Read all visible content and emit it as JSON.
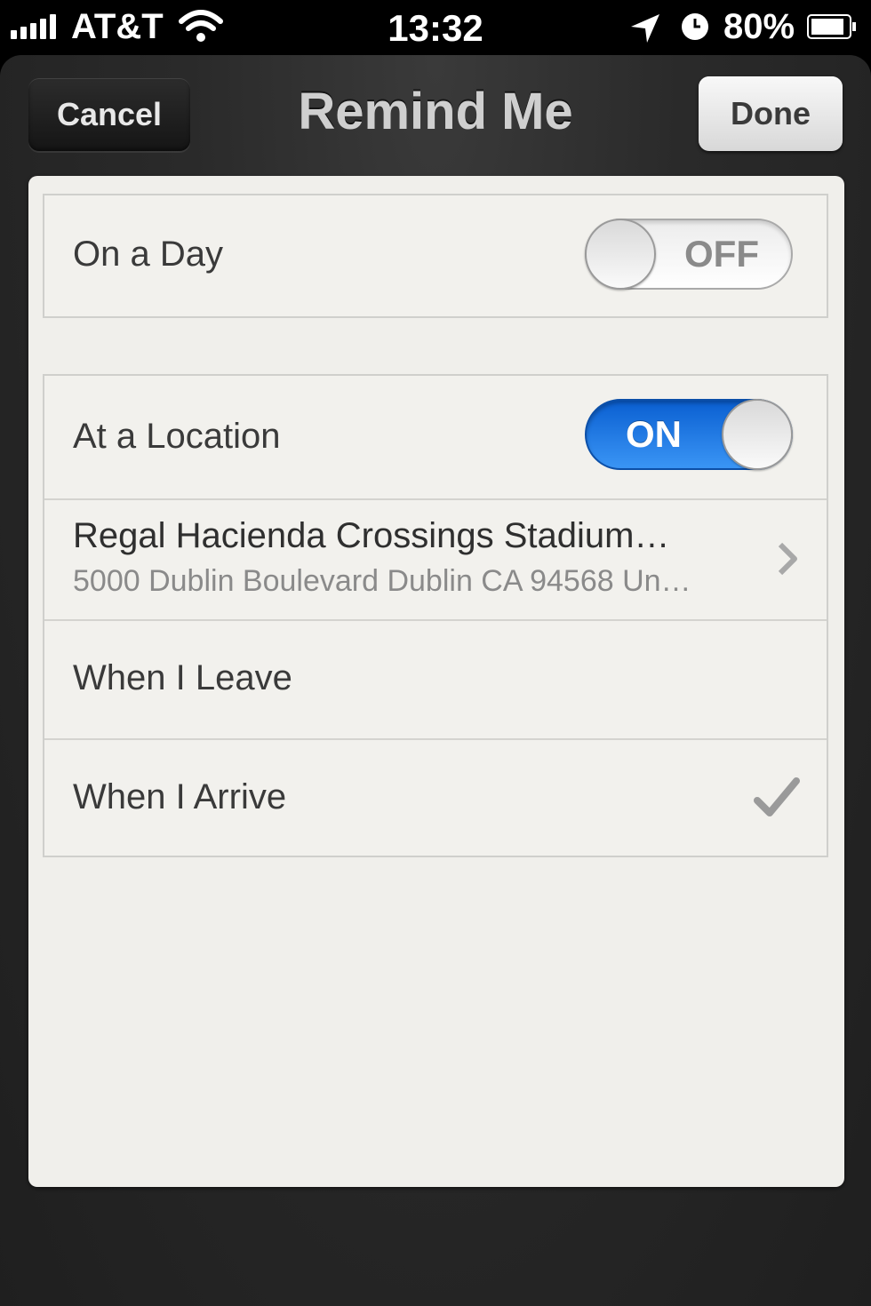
{
  "status_bar": {
    "carrier": "AT&T",
    "time": "13:32",
    "battery": "80%",
    "icons": [
      "signal-icon",
      "wifi-icon",
      "location-arrow-icon",
      "clock-icon",
      "battery-icon"
    ]
  },
  "nav": {
    "cancel_label": "Cancel",
    "title": "Remind Me",
    "done_label": "Done"
  },
  "on_a_day": {
    "label": "On a Day",
    "toggle_label": "OFF",
    "toggle_state": "off"
  },
  "location": {
    "label": "At a Location",
    "toggle_label": "ON",
    "toggle_state": "on",
    "toggle_color": "#1a78e6",
    "place_name": "Regal Hacienda Crossings Stadium…",
    "place_address": "5000 Dublin Boulevard Dublin CA 94568 Un…",
    "when_leave": "When I Leave",
    "when_arrive": "When I Arrive",
    "selected": "When I Arrive"
  }
}
